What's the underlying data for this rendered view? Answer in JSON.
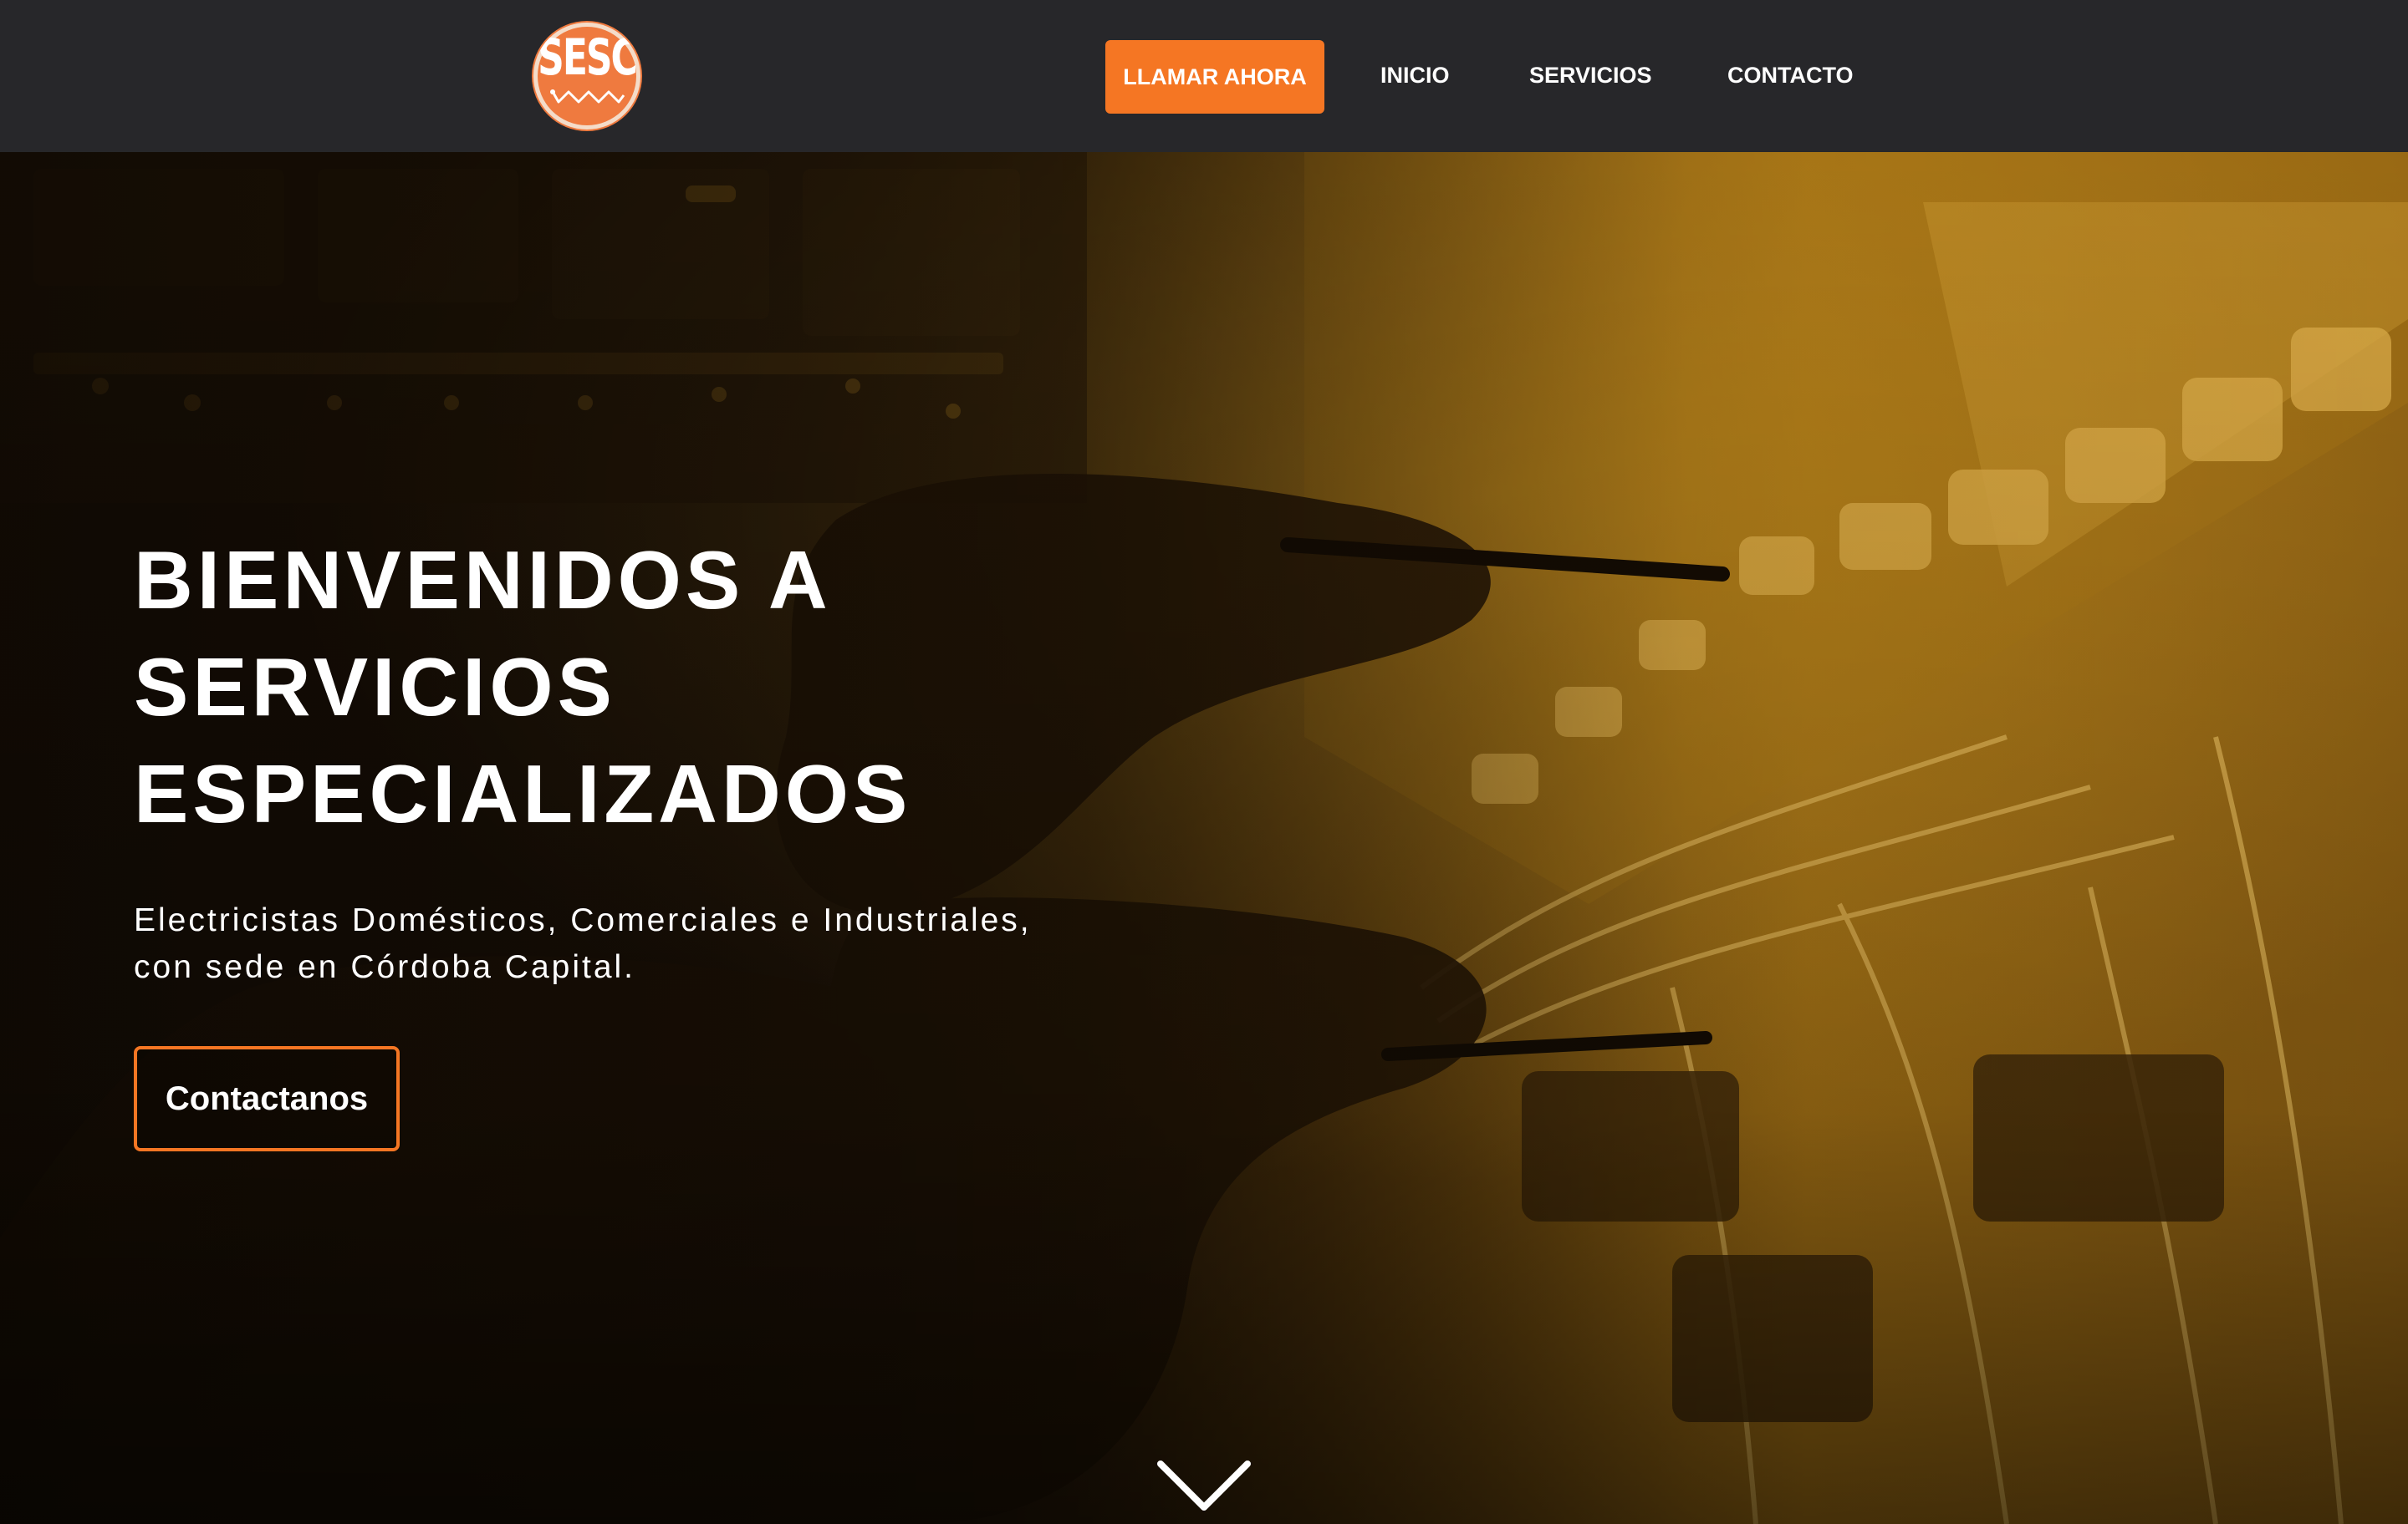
{
  "header": {
    "logo": {
      "text": "SESC",
      "icon": "sesc-logo-icon",
      "color": "#ef7a3f"
    },
    "nav": {
      "call_label": "LLAMAR AHORA",
      "items": [
        {
          "label": "INICIO"
        },
        {
          "label": "SERVICIOS"
        },
        {
          "label": "CONTACTO"
        }
      ]
    },
    "background": "#27272a"
  },
  "hero": {
    "title_lines": [
      "BIENVENIDOS A",
      "SERVICIOS",
      "ESPECIALIZADOS"
    ],
    "subtitle_lines": [
      "Electricistas Domésticos, Comerciales e Industriales,",
      "con sede en Córdoba Capital."
    ],
    "cta_label": "Contactanos",
    "scroll_icon": "chevron-down-icon",
    "background_image": "electrician-panel-photo-amber-tint"
  },
  "colors": {
    "accent": "#f57623",
    "overlay_dark": "#1b1106",
    "overlay_amber": "#c8891c"
  }
}
